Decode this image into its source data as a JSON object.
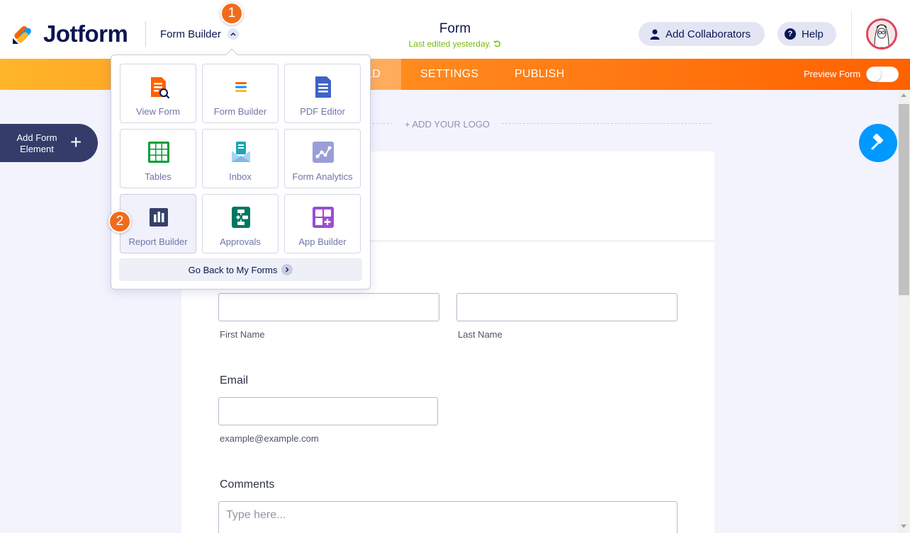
{
  "header": {
    "brand": "Jotform",
    "builder_label": "Form Builder",
    "form_title": "Form",
    "last_edited": "Last edited yesterday.",
    "add_collaborators": "Add Collaborators",
    "help": "Help",
    "help_glyph": "?"
  },
  "nav": {
    "tabs": [
      {
        "label": "BUILD",
        "visible_text": "LD",
        "active": true
      },
      {
        "label": "SETTINGS"
      },
      {
        "label": "PUBLISH"
      }
    ],
    "preview_label": "Preview Form",
    "preview_enabled": false
  },
  "sidebar": {
    "add_element_label": "Add Form Element",
    "add_element_icon": "+"
  },
  "canvas": {
    "add_logo": "+ ADD YOUR LOGO",
    "fields": {
      "first_name_sublabel": "First Name",
      "last_name_sublabel": "Last Name",
      "email_label": "Email",
      "email_sublabel": "example@example.com",
      "comments_label": "Comments",
      "comments_placeholder": "Type here..."
    }
  },
  "menu": {
    "items": [
      {
        "label": "View Form",
        "icon": "view-form-icon"
      },
      {
        "label": "Form Builder",
        "icon": "form-builder-icon"
      },
      {
        "label": "PDF Editor",
        "icon": "pdf-editor-icon"
      },
      {
        "label": "Tables",
        "icon": "tables-icon"
      },
      {
        "label": "Inbox",
        "icon": "inbox-icon"
      },
      {
        "label": "Form Analytics",
        "icon": "form-analytics-icon"
      },
      {
        "label": "Report Builder",
        "icon": "report-builder-icon"
      },
      {
        "label": "Approvals",
        "icon": "approvals-icon"
      },
      {
        "label": "App Builder",
        "icon": "app-builder-icon"
      }
    ],
    "go_back": "Go Back to My Forms"
  },
  "steps": {
    "step1": "1",
    "step2": "2"
  },
  "colors": {
    "brand_dark": "#0a1551",
    "nav_orange": "#ff6100",
    "step_orange": "#f26b1d",
    "accent_blue": "#0099ff"
  }
}
